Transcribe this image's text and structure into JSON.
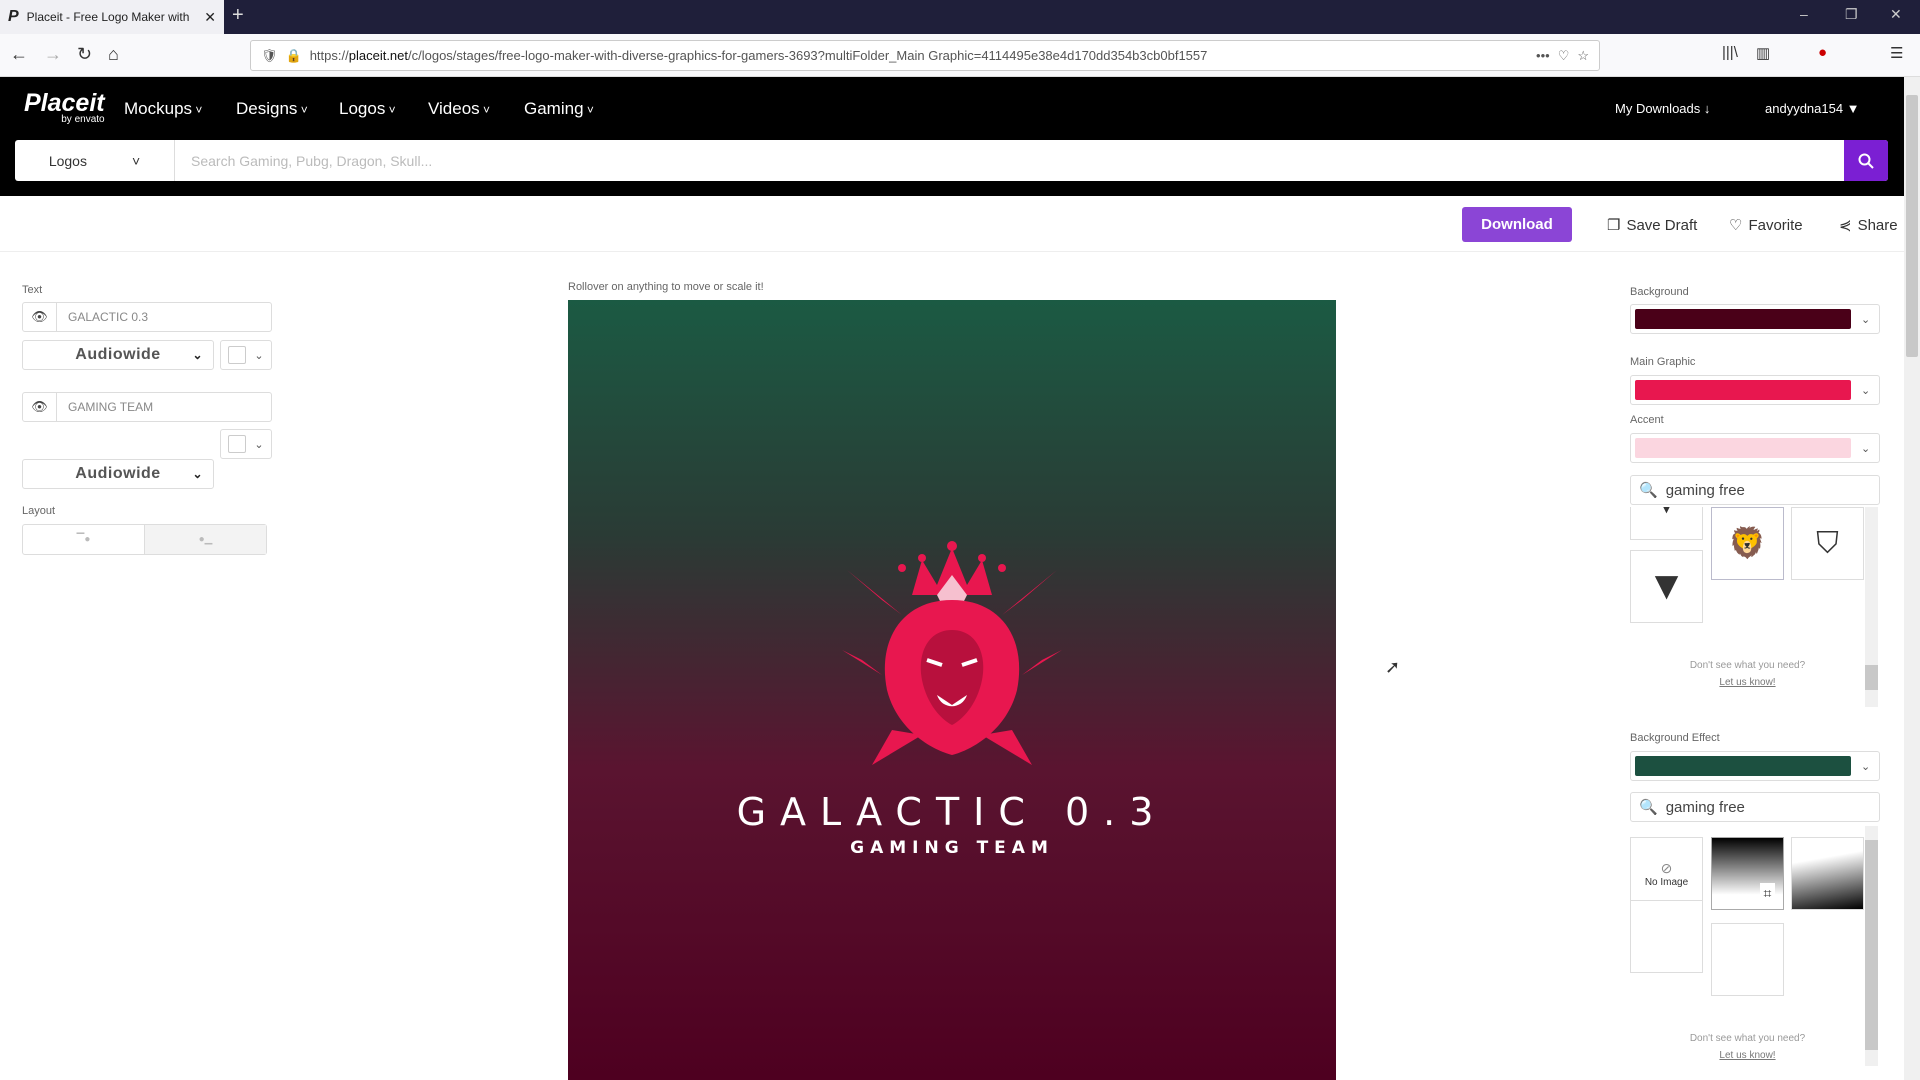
{
  "browser": {
    "tab_title": "Placeit - Free Logo Maker with",
    "url_prefix": "https://",
    "url_domain": "placeit.net",
    "url_rest": "/c/logos/stages/free-logo-maker-with-diverse-graphics-for-gamers-3693?multiFolder_Main Graphic=4114495e38e4d170dd354b3cb0bf1557"
  },
  "site": {
    "logo": "Placeit",
    "logo_sub": "by envato",
    "nav": [
      "Mockups",
      "Designs",
      "Logos",
      "Videos",
      "Gaming"
    ],
    "my_downloads": "My Downloads ↓",
    "user": "andyydna154 ▼"
  },
  "search": {
    "category": "Logos",
    "placeholder": "Search Gaming, Pubg, Dragon, Skull..."
  },
  "actions": {
    "download": "Download",
    "save_draft": "Save Draft",
    "favorite": "Favorite",
    "share": "Share"
  },
  "left": {
    "text_label": "Text",
    "texts": [
      {
        "value": "GALACTIC 0.3",
        "font": "Audiowide"
      },
      {
        "value": "GAMING TEAM",
        "font": "Audiowide"
      }
    ],
    "layout_label": "Layout"
  },
  "canvas": {
    "hint": "Rollover on anything to move or scale it!",
    "title": "GALACTIC 0.3",
    "subtitle": "GAMING TEAM"
  },
  "right": {
    "background_label": "Background",
    "background_color": "#4a0018",
    "main_graphic_label": "Main Graphic",
    "main_graphic_color": "#e8174f",
    "accent_label": "Accent",
    "accent_color": "#fbd6e0",
    "graphic_search": "gaming free",
    "help1": "Don't see what you need?",
    "help_link": "Let us know!",
    "bg_effect_label": "Background Effect",
    "bg_effect_color": "#1c5040",
    "effect_search": "gaming free",
    "no_image": "No Image"
  }
}
